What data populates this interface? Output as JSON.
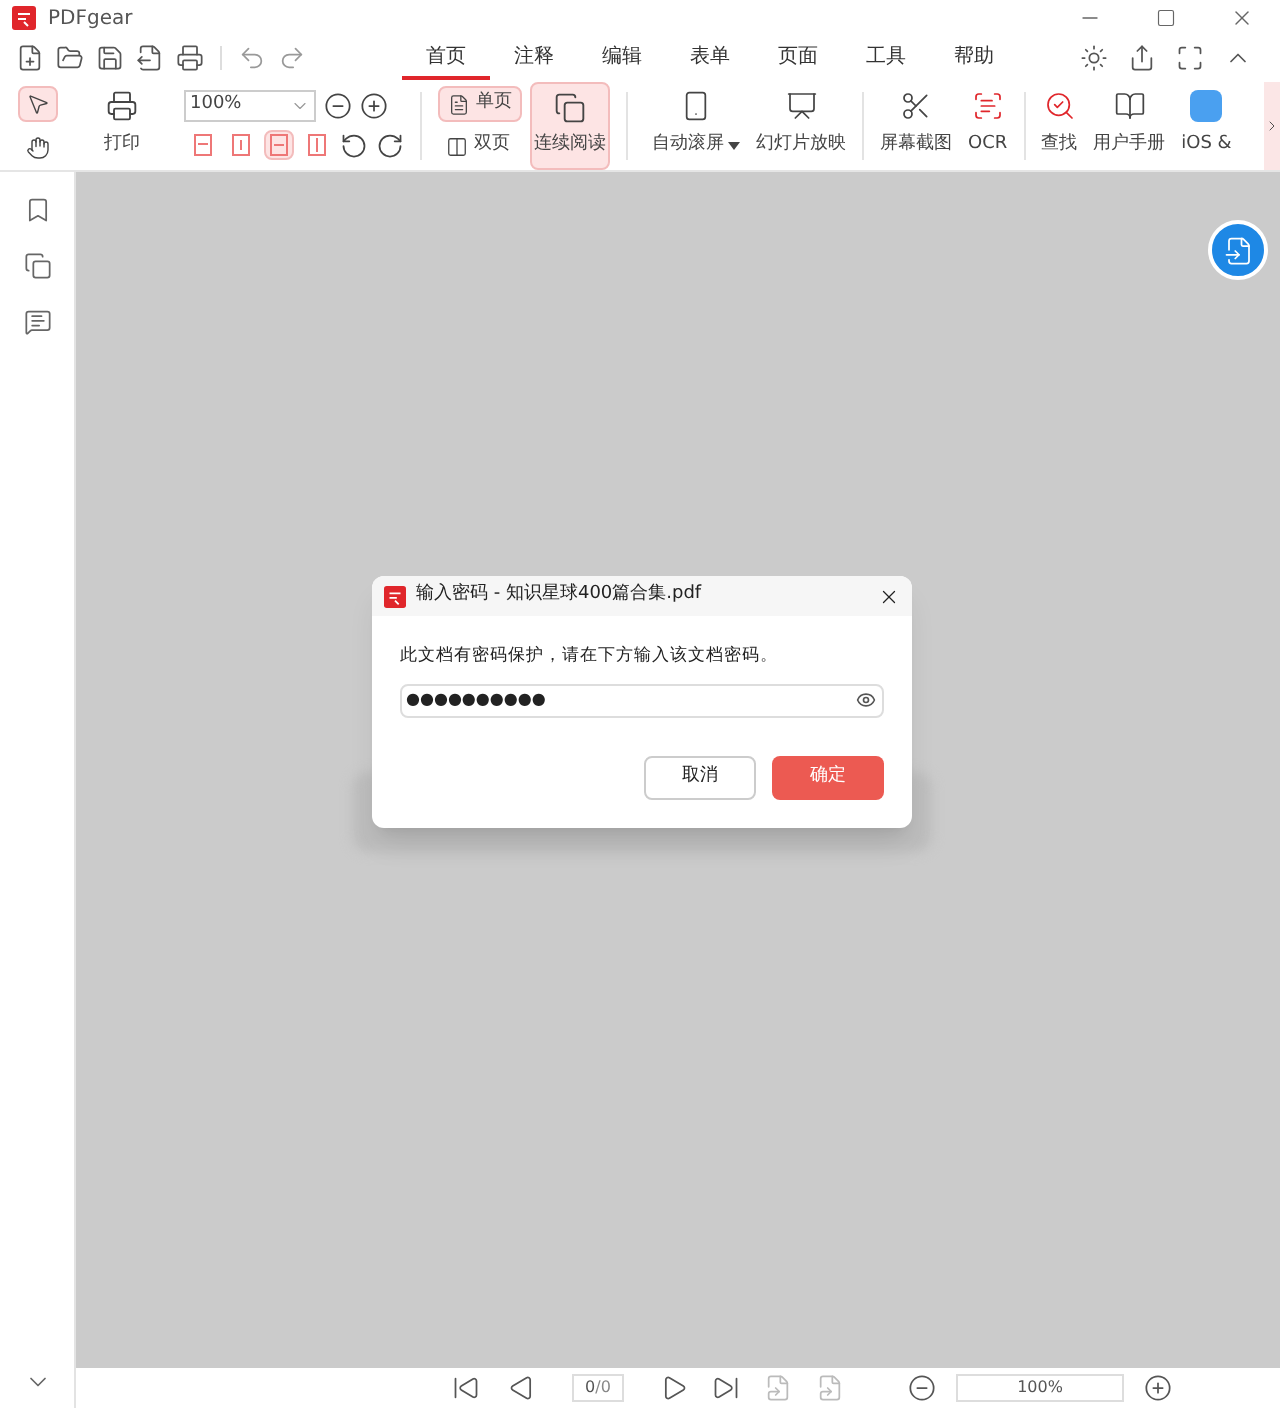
{
  "window": {
    "title": "PDFgear"
  },
  "menu_tabs": [
    {
      "label": "首页",
      "selected": true
    },
    {
      "label": "注释",
      "selected": false
    },
    {
      "label": "编辑",
      "selected": false
    },
    {
      "label": "表单",
      "selected": false
    },
    {
      "label": "页面",
      "selected": false
    },
    {
      "label": "工具",
      "selected": false
    },
    {
      "label": "帮助",
      "selected": false
    }
  ],
  "cursor_tools": [
    {
      "kind": "select",
      "selected": true
    },
    {
      "kind": "hand",
      "selected": false
    }
  ],
  "print_label": "打印",
  "zoom_field": {
    "value": "100%"
  },
  "fit_modes": [
    {
      "kind": "actual",
      "selected": false
    },
    {
      "kind": "page",
      "selected": false
    },
    {
      "kind": "width",
      "selected": true
    },
    {
      "kind": "height",
      "selected": false
    }
  ],
  "page_modes": [
    {
      "label": "单页",
      "selected": true
    },
    {
      "label": "双页",
      "selected": false
    }
  ],
  "continuous": {
    "label": "连续阅读",
    "selected": true
  },
  "tools": [
    {
      "kind": "scroll",
      "label": "自动滚屏",
      "dropdown": true
    },
    {
      "kind": "slideshow",
      "label": "幻灯片放映",
      "dropdown": false
    },
    {
      "kind": "screenshot",
      "label": "屏幕截图",
      "dropdown": false
    },
    {
      "kind": "ocr",
      "label": "OCR",
      "dropdown": false
    },
    {
      "kind": "find",
      "label": "查找",
      "dropdown": false
    },
    {
      "kind": "manual",
      "label": "用户手册",
      "dropdown": false
    },
    {
      "kind": "ios",
      "label": "iOS &",
      "dropdown": false
    }
  ],
  "dialog": {
    "title": "输入密码 - 知识星球400篇合集.pdf",
    "message": "此文档有密码保护，请在下方输入该文档密码。",
    "password": "●●●●●●●●●●",
    "buttons": [
      {
        "kind": "secondary",
        "label": "取消"
      },
      {
        "kind": "primary",
        "label": "确定"
      }
    ]
  },
  "status_bar": {
    "page": "0",
    "total": "/0",
    "zoom": "100%"
  }
}
